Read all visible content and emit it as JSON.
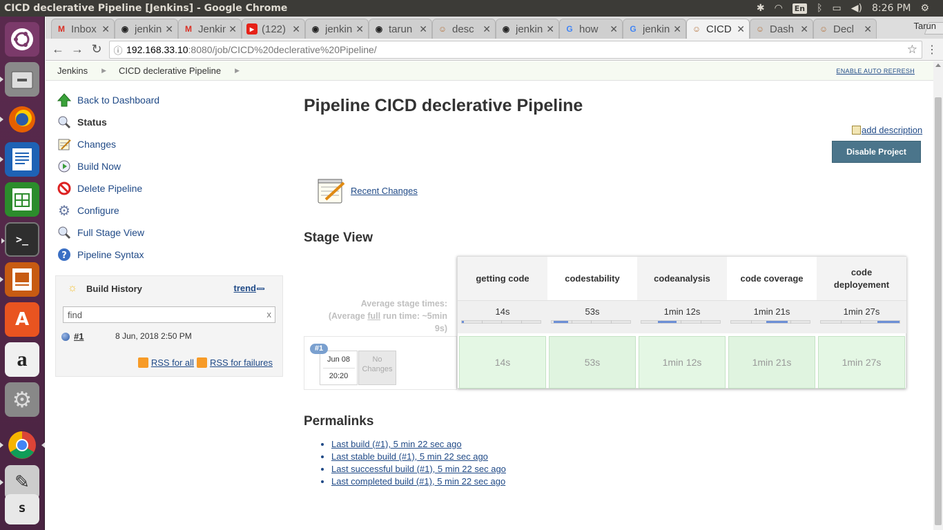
{
  "window": {
    "title": "CICD declerative Pipeline [Jenkins] - Google Chrome",
    "keyboard_layout": "En",
    "clock": "8:26 PM",
    "icons": [
      "network-icon",
      "wifi-icon",
      "bluetooth-icon",
      "battery-icon",
      "volume-icon",
      "power-icon"
    ]
  },
  "launcher": {
    "items": [
      "ubuntu-dash",
      "files",
      "firefox",
      "libreoffice-writer",
      "libreoffice-calc",
      "terminal",
      "libreoffice-impress",
      "software-center",
      "amazon",
      "system-settings",
      "chrome",
      "text-editor",
      "stack-app"
    ]
  },
  "tabs": [
    {
      "label": "Inbox",
      "icon": "gmail-icon",
      "active": false
    },
    {
      "label": "jenkins",
      "icon": "github-icon",
      "active": false
    },
    {
      "label": "Jenkins",
      "icon": "gmail-icon",
      "active": false
    },
    {
      "label": "(122)",
      "icon": "youtube-icon",
      "active": false
    },
    {
      "label": "jenkins",
      "icon": "github-icon",
      "active": false
    },
    {
      "label": "tarun",
      "icon": "github-icon",
      "active": false
    },
    {
      "label": "desc",
      "icon": "jenkins-icon",
      "active": false
    },
    {
      "label": "jenkins",
      "icon": "github-icon",
      "active": false
    },
    {
      "label": "how",
      "icon": "google-icon",
      "active": false
    },
    {
      "label": "jenkins",
      "icon": "google-icon",
      "active": false
    },
    {
      "label": "CICD",
      "icon": "jenkins-icon",
      "active": true
    },
    {
      "label": "Dash",
      "icon": "jenkins-icon",
      "active": false
    },
    {
      "label": "Decl",
      "icon": "jenkins-icon",
      "active": false
    }
  ],
  "profile_name": "Tarun",
  "address": {
    "host": "192.168.33.10",
    "path": ":8080/job/CICD%20declerative%20Pipeline/"
  },
  "breadcrumb": {
    "items": [
      "Jenkins",
      "CICD declerative Pipeline"
    ],
    "auto_refresh": "ENABLE AUTO REFRESH"
  },
  "sidebar": {
    "tasks": [
      {
        "label": "Back to Dashboard",
        "icon": "up-arrow-icon"
      },
      {
        "label": "Status",
        "icon": "magnifier-icon",
        "current": true
      },
      {
        "label": "Changes",
        "icon": "notepad-icon"
      },
      {
        "label": "Build Now",
        "icon": "clock-play-icon"
      },
      {
        "label": "Delete Pipeline",
        "icon": "no-entry-icon"
      },
      {
        "label": "Configure",
        "icon": "gear-icon"
      },
      {
        "label": "Full Stage View",
        "icon": "magnifier-icon"
      },
      {
        "label": "Pipeline Syntax",
        "icon": "help-icon"
      }
    ]
  },
  "build_history": {
    "title": "Build History",
    "trend": "trend",
    "find_value": "find",
    "clear": "x",
    "builds": [
      {
        "number": "#1",
        "date": "8 Jun, 2018 2:50 PM"
      }
    ],
    "rss_all": "RSS for all",
    "rss_failures": "RSS for failures"
  },
  "main": {
    "title": "Pipeline CICD declerative Pipeline",
    "add_description": "add description",
    "disable_button": "Disable Project",
    "recent_changes": "Recent Changes",
    "stage_view_title": "Stage View",
    "permalinks_title": "Permalinks",
    "permalinks": [
      "Last build (#1), 5 min 22 sec ago",
      "Last stable build (#1), 5 min 22 sec ago",
      "Last successful build (#1), 5 min 22 sec ago",
      "Last completed build (#1), 5 min 22 sec ago"
    ]
  },
  "stage_view": {
    "avg_line1": "Average stage times:",
    "avg_line2_pre": "(Average ",
    "avg_line2_full": "full",
    "avg_line2_post": " run time: ~5min",
    "avg_line3": "9s)",
    "build_badge": "#1",
    "build_date": "Jun 08",
    "build_time": "20:20",
    "no_changes": "No Changes",
    "stages": [
      {
        "name": "getting code",
        "avg": "14s",
        "build1": "14s",
        "bar_start": 0.0,
        "bar_end": 0.03
      },
      {
        "name": "codestability",
        "avg": "53s",
        "build1": "53s",
        "bar_start": 0.03,
        "bar_end": 0.21
      },
      {
        "name": "codeanalysis",
        "avg": "1min 12s",
        "build1": "1min 12s",
        "bar_start": 0.21,
        "bar_end": 0.45
      },
      {
        "name": "code coverage",
        "avg": "1min 21s",
        "build1": "1min 21s",
        "bar_start": 0.45,
        "bar_end": 0.72
      },
      {
        "name": "code deployement",
        "avg": "1min 27s",
        "build1": "1min 27s",
        "bar_start": 0.72,
        "bar_end": 1.0
      }
    ]
  }
}
